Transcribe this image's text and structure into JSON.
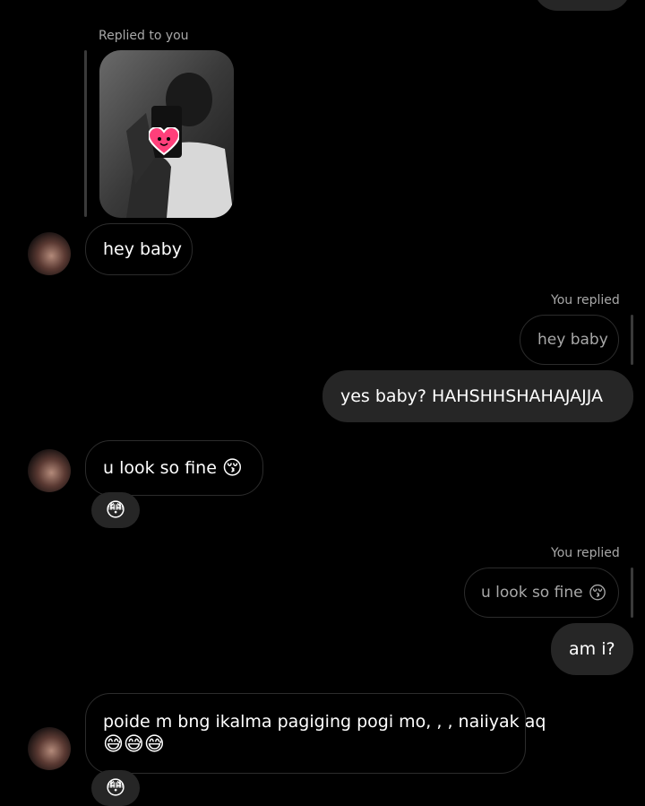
{
  "thread": {
    "reply_to_you_label": "Replied to you",
    "you_replied_label": "You replied",
    "messages": [
      {
        "text": "hey baby"
      },
      {
        "quoted": "hey baby",
        "text": "yes baby?  HAHSHHSHAHAJAJJA"
      },
      {
        "text": "u look so fine",
        "emoji": "😚",
        "reaction": "😳"
      },
      {
        "quoted": "u look so fine",
        "quoted_emoji": "😚",
        "text": "am i?"
      },
      {
        "line1": "poide m bng ikalma pagiging pogi mo, , ,  naiiyak aq",
        "line2": "😅😅😅",
        "reaction": "😳"
      }
    ]
  },
  "colors": {
    "background": "#000000",
    "outgoing_bubble": "#262626",
    "incoming_border": "#2c2c2c",
    "muted_text": "#a8a8a8"
  },
  "icons": {
    "sticker": "pink-heart-face-sticker"
  }
}
